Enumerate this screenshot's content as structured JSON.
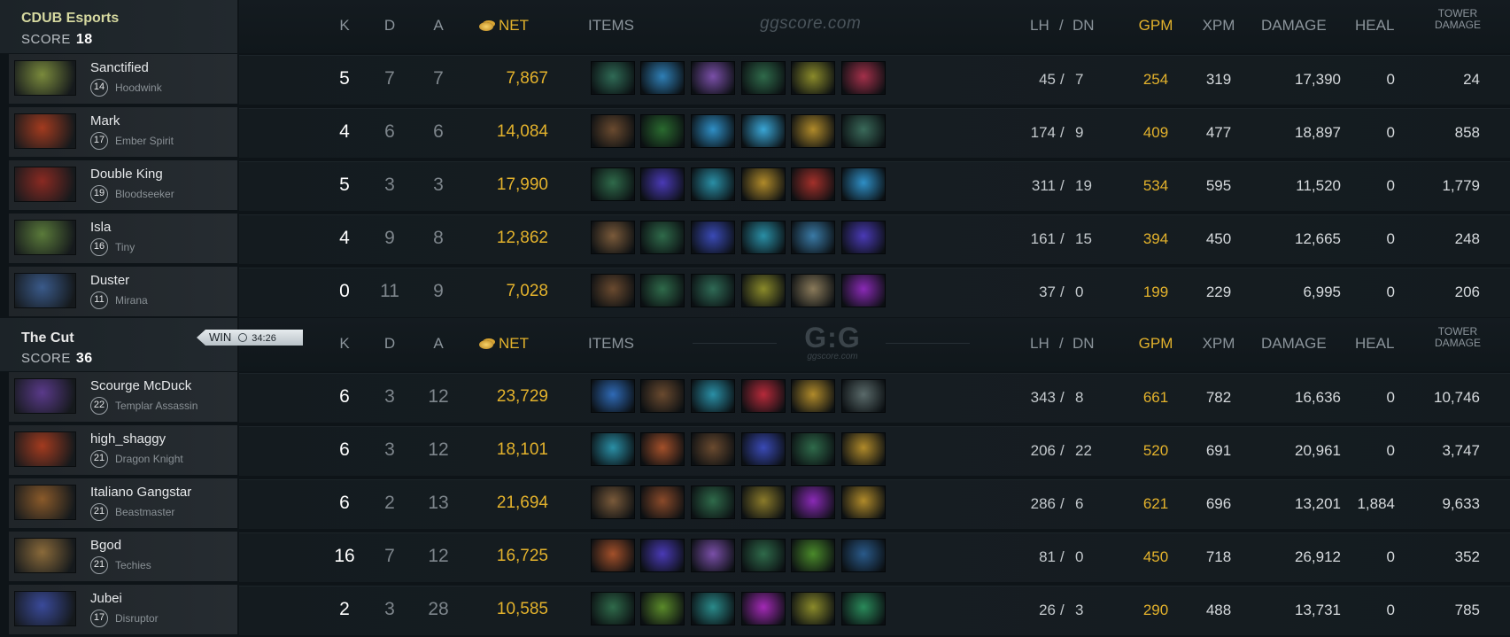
{
  "watermark": "ggscore.com",
  "watermark_logo": {
    "big": "G:G",
    "small": "ggscore.com"
  },
  "headers": {
    "k": "K",
    "d": "D",
    "a": "A",
    "net": "NET",
    "items": "ITEMS",
    "lh": "LH",
    "slash": "/",
    "dn": "DN",
    "gpm": "GPM",
    "xpm": "XPM",
    "damage": "DAMAGE",
    "heal": "HEAL",
    "tower_line1": "TOWER",
    "tower_line2": "DAMAGE"
  },
  "colors": {
    "gold": "#e3b22c",
    "accent_team1": "#d6d9a0"
  },
  "result": {
    "label": "WIN",
    "duration": "34:26",
    "clock_icon": "clock-icon"
  },
  "teams": [
    {
      "name": "CDUB Esports",
      "score_label": "SCORE",
      "score": "18",
      "players": [
        {
          "name": "Sanctified",
          "level": "14",
          "hero": "Hoodwink",
          "hero_color": "#7a8a3c",
          "k": "5",
          "d": "7",
          "a": "7",
          "net": "7,867",
          "lh": "45",
          "dn": "7",
          "gpm": "254",
          "xpm": "319",
          "damage": "17,390",
          "heal": "0",
          "tower": "24",
          "items": [
            {
              "icon": "staff-item-icon",
              "c": "#2f6a55"
            },
            {
              "icon": "orb-item-icon",
              "c": "#2f7fb6"
            },
            {
              "icon": "bottle-item-icon",
              "c": "#7a4fa8"
            },
            {
              "icon": "branch-item-icon",
              "c": "#2f6a4a"
            },
            {
              "icon": "mask-item-icon",
              "c": "#8a8a2a"
            },
            {
              "icon": "armor-item-icon",
              "c": "#a3304a"
            }
          ]
        },
        {
          "name": "Mark",
          "level": "17",
          "hero": "Ember Spirit",
          "hero_color": "#a33b1f",
          "k": "4",
          "d": "6",
          "a": "6",
          "net": "14,084",
          "lh": "174",
          "dn": "9",
          "gpm": "409",
          "xpm": "477",
          "damage": "18,897",
          "heal": "0",
          "tower": "858",
          "items": [
            {
              "icon": "boots-item-icon",
              "c": "#6a4a2f"
            },
            {
              "icon": "wraith-item-icon",
              "c": "#2a6a2f"
            },
            {
              "icon": "maelstrom-item-icon",
              "c": "#2f8fc6"
            },
            {
              "icon": "crystal-item-icon",
              "c": "#3aa6d6"
            },
            {
              "icon": "helm-item-icon",
              "c": "#b08a2a"
            },
            {
              "icon": "chest-item-icon",
              "c": "#3a6a5a"
            }
          ]
        },
        {
          "name": "Double King",
          "level": "19",
          "hero": "Bloodseeker",
          "hero_color": "#8a2a22",
          "k": "5",
          "d": "3",
          "a": "3",
          "net": "17,990",
          "lh": "311",
          "dn": "19",
          "gpm": "534",
          "xpm": "595",
          "damage": "11,520",
          "heal": "0",
          "tower": "1,779",
          "items": [
            {
              "icon": "branch-item-icon",
              "c": "#2f6a4a"
            },
            {
              "icon": "cloak-item-icon",
              "c": "#4a3ab6"
            },
            {
              "icon": "blade-item-icon",
              "c": "#2a8fa6"
            },
            {
              "icon": "helm-item-icon",
              "c": "#b08a2a"
            },
            {
              "icon": "gauntlet-item-icon",
              "c": "#a3302a"
            },
            {
              "icon": "maelstrom-item-icon",
              "c": "#2f8fc6"
            }
          ]
        },
        {
          "name": "Isla",
          "level": "16",
          "hero": "Tiny",
          "hero_color": "#5a7a3a",
          "k": "4",
          "d": "9",
          "a": "8",
          "net": "12,862",
          "lh": "161",
          "dn": "15",
          "gpm": "394",
          "xpm": "450",
          "damage": "12,665",
          "heal": "0",
          "tower": "248",
          "items": [
            {
              "icon": "axe-item-icon",
              "c": "#7a5a3a"
            },
            {
              "icon": "branch-item-icon",
              "c": "#2f6a4a"
            },
            {
              "icon": "scepter-item-icon",
              "c": "#3a4ab6"
            },
            {
              "icon": "blade-item-icon",
              "c": "#2a8fa6"
            },
            {
              "icon": "wand-item-icon",
              "c": "#3a7aa6"
            },
            {
              "icon": "cloak-item-icon",
              "c": "#4a3ab6"
            }
          ]
        },
        {
          "name": "Duster",
          "level": "11",
          "hero": "Mirana",
          "hero_color": "#3a5a8a",
          "k": "0",
          "d": "11",
          "a": "9",
          "net": "7,028",
          "lh": "37",
          "dn": "0",
          "gpm": "199",
          "xpm": "229",
          "damage": "6,995",
          "heal": "0",
          "tower": "206",
          "items": [
            {
              "icon": "boots-item-icon",
              "c": "#6a4a2f"
            },
            {
              "icon": "branch-item-icon",
              "c": "#2f6a4a"
            },
            {
              "icon": "staff-item-icon",
              "c": "#2f6a55"
            },
            {
              "icon": "mask-item-icon",
              "c": "#8a8a2a"
            },
            {
              "icon": "shield-item-icon",
              "c": "#8a7a5a"
            },
            {
              "icon": "ring-item-icon",
              "c": "#8a2ab6"
            }
          ]
        }
      ]
    },
    {
      "name": "The Cut",
      "score_label": "SCORE",
      "score": "36",
      "players": [
        {
          "name": "Scourge McDuck",
          "level": "22",
          "hero": "Templar Assassin",
          "hero_color": "#5a3a8a",
          "k": "6",
          "d": "3",
          "a": "12",
          "net": "23,729",
          "lh": "343",
          "dn": "8",
          "gpm": "661",
          "xpm": "782",
          "damage": "16,636",
          "heal": "0",
          "tower": "10,746",
          "items": [
            {
              "icon": "orb-item-icon",
              "c": "#2f6ab6"
            },
            {
              "icon": "boots-item-icon",
              "c": "#6a4a2f"
            },
            {
              "icon": "blade-item-icon",
              "c": "#2a8fa6"
            },
            {
              "icon": "scythe-item-icon",
              "c": "#b62a3a"
            },
            {
              "icon": "helm-item-icon",
              "c": "#b08a2a"
            },
            {
              "icon": "claw-item-icon",
              "c": "#5a6a6a"
            }
          ]
        },
        {
          "name": "high_shaggy",
          "level": "21",
          "hero": "Dragon Knight",
          "hero_color": "#a33b1f",
          "k": "6",
          "d": "3",
          "a": "12",
          "net": "18,101",
          "lh": "206",
          "dn": "22",
          "gpm": "520",
          "xpm": "691",
          "damage": "20,961",
          "heal": "0",
          "tower": "3,747",
          "items": [
            {
              "icon": "blade-item-icon",
              "c": "#2a8fa6"
            },
            {
              "icon": "bracer-item-icon",
              "c": "#a3502a"
            },
            {
              "icon": "boots-item-icon",
              "c": "#6a4a2f"
            },
            {
              "icon": "scepter-item-icon",
              "c": "#3a4ab6"
            },
            {
              "icon": "branch-item-icon",
              "c": "#2f6a4a"
            },
            {
              "icon": "helm-item-icon",
              "c": "#b08a2a"
            }
          ]
        },
        {
          "name": "Italiano Gangstar",
          "level": "21",
          "hero": "Beastmaster",
          "hero_color": "#8a5a2a",
          "k": "6",
          "d": "2",
          "a": "13",
          "net": "21,694",
          "lh": "286",
          "dn": "6",
          "gpm": "621",
          "xpm": "696",
          "damage": "13,201",
          "heal": "1,884",
          "tower": "9,633",
          "items": [
            {
              "icon": "axe-item-icon",
              "c": "#7a5a3a"
            },
            {
              "icon": "helmet-item-icon",
              "c": "#8a4a2a"
            },
            {
              "icon": "branch-item-icon",
              "c": "#2f6a4a"
            },
            {
              "icon": "drum-item-icon",
              "c": "#8a7a2a"
            },
            {
              "icon": "orb-item-icon",
              "c": "#8a2ab6"
            },
            {
              "icon": "helm-item-icon",
              "c": "#b08a2a"
            }
          ]
        },
        {
          "name": "Bgod",
          "level": "21",
          "hero": "Techies",
          "hero_color": "#8a6a3a",
          "k": "16",
          "d": "7",
          "a": "12",
          "net": "16,725",
          "lh": "81",
          "dn": "0",
          "gpm": "450",
          "xpm": "718",
          "damage": "26,912",
          "heal": "0",
          "tower": "352",
          "items": [
            {
              "icon": "boot-item-icon",
              "c": "#a3502a"
            },
            {
              "icon": "cloak-item-icon",
              "c": "#4a3ab6"
            },
            {
              "icon": "bottle-item-icon",
              "c": "#7a4fa8"
            },
            {
              "icon": "branch-item-icon",
              "c": "#2f6a4a"
            },
            {
              "icon": "sword-item-icon",
              "c": "#4a8a2a"
            },
            {
              "icon": "lens-item-icon",
              "c": "#2a5a8a"
            }
          ]
        },
        {
          "name": "Jubei",
          "level": "17",
          "hero": "Disruptor",
          "hero_color": "#3a4a9a",
          "k": "2",
          "d": "3",
          "a": "28",
          "net": "10,585",
          "lh": "26",
          "dn": "3",
          "gpm": "290",
          "xpm": "488",
          "damage": "13,731",
          "heal": "0",
          "tower": "785",
          "items": [
            {
              "icon": "branch-item-icon",
              "c": "#2f6a4a"
            },
            {
              "icon": "seed-item-icon",
              "c": "#5a8a2a"
            },
            {
              "icon": "wisp-item-icon",
              "c": "#2a8a8a"
            },
            {
              "icon": "gem-item-icon",
              "c": "#a32ab6"
            },
            {
              "icon": "mask-item-icon",
              "c": "#8a8a2a"
            },
            {
              "icon": "tranquil-item-icon",
              "c": "#2a8a5a"
            }
          ]
        }
      ]
    }
  ]
}
